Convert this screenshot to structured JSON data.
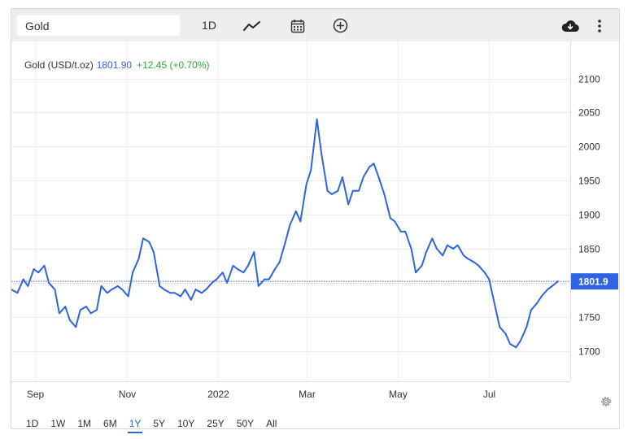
{
  "toolbar": {
    "symbol_value": "Gold",
    "period_label": "1D",
    "icons": [
      "line-chart-icon",
      "calendar-icon",
      "add-circle-icon",
      "cloud-download-icon",
      "more-vertical-icon",
      "settings-gear-icon"
    ]
  },
  "info": {
    "name": "Gold (USD/t.oz)",
    "price": "1801.90",
    "change": "+12.45 (+0.70%)"
  },
  "current_price_label": "1801.9",
  "ranges": [
    "1D",
    "1W",
    "1M",
    "6M",
    "1Y",
    "5Y",
    "10Y",
    "25Y",
    "50Y",
    "All"
  ],
  "active_range": "1Y",
  "colors": {
    "line": "#2e64e3",
    "price_tag": "#2e64e3",
    "change_positive": "#2eaa3f",
    "toolbar_bg": "#eeeeee"
  },
  "chart_data": {
    "type": "line",
    "title": "Gold (USD/t.oz)",
    "x_tick_labels": [
      "Sep",
      "Nov",
      "2022",
      "Mar",
      "May",
      "Jul"
    ],
    "y_ticks": [
      1700,
      1750,
      1800,
      1850,
      1900,
      1950,
      2000,
      2050,
      2100
    ],
    "ylim": [
      1660,
      2115
    ],
    "y_axis_side": "right",
    "grid": true,
    "last_value": 1801.9,
    "series": [
      {
        "x": [
          "2021-08-16",
          "2021-08-20",
          "2021-08-24",
          "2021-08-27",
          "2021-08-31",
          "2021-09-03",
          "2021-09-07",
          "2021-09-10",
          "2021-09-14",
          "2021-09-17",
          "2021-09-21",
          "2021-09-24",
          "2021-09-28",
          "2021-10-01",
          "2021-10-05",
          "2021-10-08",
          "2021-10-12",
          "2021-10-15",
          "2021-10-19",
          "2021-10-22",
          "2021-10-26",
          "2021-10-29",
          "2021-11-02",
          "2021-11-05",
          "2021-11-09",
          "2021-11-12",
          "2021-11-16",
          "2021-11-19",
          "2021-11-23",
          "2021-11-26",
          "2021-11-30",
          "2021-12-03",
          "2021-12-07",
          "2021-12-10",
          "2021-12-14",
          "2021-12-17",
          "2021-12-21",
          "2021-12-24",
          "2021-12-28",
          "2021-12-31",
          "2022-01-04",
          "2022-01-07",
          "2022-01-11",
          "2022-01-14",
          "2022-01-18",
          "2022-01-21",
          "2022-01-25",
          "2022-01-28",
          "2022-02-01",
          "2022-02-04",
          "2022-02-08",
          "2022-02-11",
          "2022-02-15",
          "2022-02-18",
          "2022-02-22",
          "2022-02-25",
          "2022-03-01",
          "2022-03-04",
          "2022-03-08",
          "2022-03-11",
          "2022-03-15",
          "2022-03-18",
          "2022-03-22",
          "2022-03-25",
          "2022-03-29",
          "2022-04-01",
          "2022-04-05",
          "2022-04-08",
          "2022-04-12",
          "2022-04-15",
          "2022-04-19",
          "2022-04-22",
          "2022-04-26",
          "2022-04-29",
          "2022-05-03",
          "2022-05-06",
          "2022-05-10",
          "2022-05-13",
          "2022-05-17",
          "2022-05-20",
          "2022-05-24",
          "2022-05-27",
          "2022-05-31",
          "2022-06-03",
          "2022-06-07",
          "2022-06-10",
          "2022-06-14",
          "2022-06-17",
          "2022-06-21",
          "2022-06-24",
          "2022-06-28",
          "2022-07-01",
          "2022-07-05",
          "2022-07-08",
          "2022-07-12",
          "2022-07-15",
          "2022-07-19",
          "2022-07-22",
          "2022-07-26",
          "2022-07-29",
          "2022-08-02",
          "2022-08-05",
          "2022-08-09",
          "2022-08-12",
          "2022-08-16"
        ],
        "values": [
          1790,
          1785,
          1805,
          1795,
          1820,
          1815,
          1825,
          1800,
          1790,
          1755,
          1765,
          1745,
          1735,
          1760,
          1765,
          1755,
          1760,
          1795,
          1785,
          1790,
          1795,
          1790,
          1780,
          1815,
          1835,
          1865,
          1860,
          1845,
          1795,
          1790,
          1785,
          1785,
          1780,
          1790,
          1775,
          1790,
          1785,
          1790,
          1800,
          1805,
          1815,
          1800,
          1825,
          1820,
          1815,
          1825,
          1845,
          1795,
          1805,
          1805,
          1820,
          1830,
          1860,
          1885,
          1905,
          1890,
          1945,
          1965,
          2040,
          1990,
          1935,
          1930,
          1935,
          1955,
          1915,
          1935,
          1935,
          1955,
          1970,
          1975,
          1950,
          1930,
          1895,
          1890,
          1875,
          1875,
          1850,
          1815,
          1825,
          1845,
          1865,
          1850,
          1840,
          1855,
          1850,
          1855,
          1840,
          1835,
          1830,
          1825,
          1815,
          1805,
          1765,
          1735,
          1725,
          1710,
          1705,
          1715,
          1735,
          1760,
          1770,
          1780,
          1790,
          1795,
          1802
        ]
      }
    ]
  }
}
